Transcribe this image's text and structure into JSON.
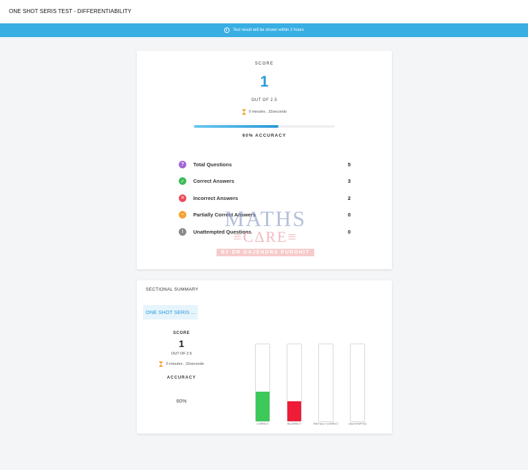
{
  "header": {
    "title": "ONE SHOT SERIS TEST - DIFFERENTIABILITY"
  },
  "banner": {
    "text": "Test result will be shown within 2 hours",
    "icon": "info-icon"
  },
  "score_card": {
    "score_label": "SCORE",
    "score_value": "1",
    "out_of": "OUT OF 2.5",
    "time": "0 minutes , 32seconds",
    "progress": 0.6,
    "accuracy_label": "60% ACCURACY",
    "stats": [
      {
        "label": "Total Questions",
        "value": "5",
        "icon": "question-icon",
        "color": "#a265d8",
        "glyph": "?"
      },
      {
        "label": "Correct Answers",
        "value": "3",
        "icon": "check-icon",
        "color": "#3cba5a",
        "glyph": "✓"
      },
      {
        "label": "Incorrect Answers",
        "value": "2",
        "icon": "cross-icon",
        "color": "#ec4a5a",
        "glyph": "✕"
      },
      {
        "label": "Partially Correct Answers",
        "value": "0",
        "icon": "partial-icon",
        "color": "#f3a233",
        "glyph": "–"
      },
      {
        "label": "Unattempted Questions",
        "value": "0",
        "icon": "exclamation-icon",
        "color": "#888888",
        "glyph": "!"
      }
    ]
  },
  "watermark": {
    "line1": "MATHS",
    "line2": "≡CΔRE≡",
    "line3": "BY DR GAJENDRA PUROHIT"
  },
  "sectional": {
    "title": "SECTIONAL SUMMARY",
    "tab_label": "ONE SHOT SERIS ...",
    "score_label": "SCORE",
    "score_value": "1",
    "out_of": "OUT OF 2.5",
    "time": "0 minutes , 32seconds",
    "accuracy_label": "ACCURACY",
    "accuracy_value": "60%"
  },
  "chart_data": {
    "type": "bar",
    "categories": [
      "CORRECT",
      "INCORRECT",
      "PARTIALLY CORRECT",
      "UNATTEMPTED"
    ],
    "values": [
      0.385,
      0.26,
      0,
      0
    ],
    "colors": [
      "#3cc95a",
      "#ee1c36",
      "#ffffff",
      "#ffffff"
    ]
  }
}
